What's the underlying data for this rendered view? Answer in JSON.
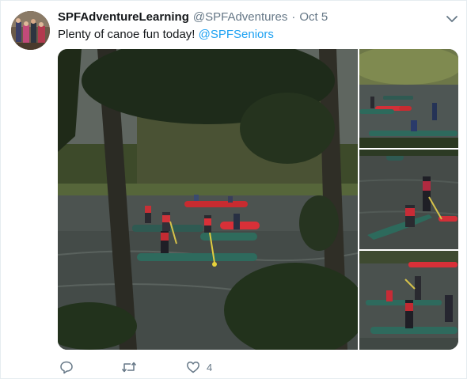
{
  "tweet": {
    "author_name": "SPFAdventureLearning",
    "author_handle": "@SPFAdventures",
    "separator": "·",
    "timestamp": "Oct 5",
    "text": "Plenty of canoe fun today!",
    "mention": "@SPFSeniors",
    "likes": "4"
  },
  "media": {
    "photo_count": 4,
    "subject": "canoes on a lake"
  },
  "icons": {
    "caret": "chevron-down-icon",
    "reply": "reply-icon",
    "retweet": "retweet-icon",
    "like": "heart-icon"
  },
  "colors": {
    "link": "#1da1f2",
    "secondary_text": "#657786",
    "primary_text": "#14171a",
    "border": "#e6ecf0"
  }
}
